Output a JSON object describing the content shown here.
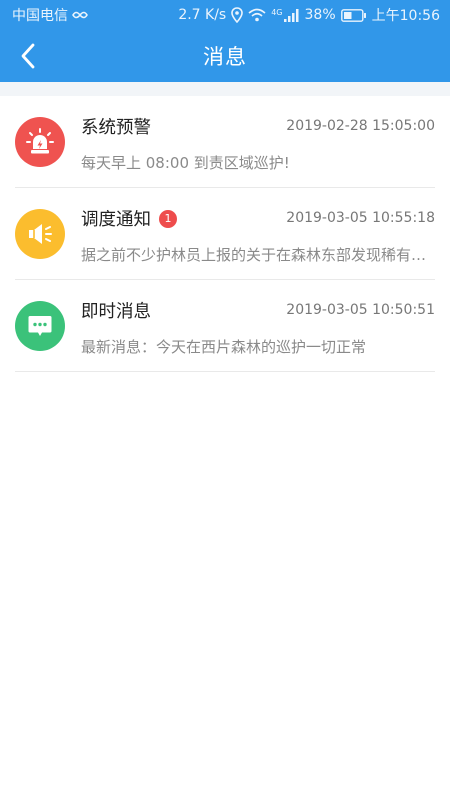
{
  "statusbar": {
    "carrier": "中国电信",
    "speed": "2.7 K/s",
    "network": "4G",
    "battery": "38%",
    "time": "上午10:56"
  },
  "header": {
    "title": "消息"
  },
  "colors": {
    "primary": "#3197e9",
    "alert": "#ef5350",
    "dispatch": "#fbbd2e",
    "instant": "#3bc27a",
    "badge": "#ee4c4c"
  },
  "messages": [
    {
      "icon": "alarm-light-icon",
      "title": "系统预警",
      "time": "2019-02-28 15:05:00",
      "preview": "每天早上 08:00 到责区域巡护!",
      "badge": ""
    },
    {
      "icon": "speaker-icon",
      "title": "调度通知",
      "time": "2019-03-05 10:55:18",
      "preview": "据之前不少护林员上报的关于在森林东部发现稀有植物的情况",
      "badge": "1"
    },
    {
      "icon": "chat-bubble-icon",
      "title": "即时消息",
      "time": "2019-03-05 10:50:51",
      "preview": "最新消息：今天在西片森林的巡护一切正常",
      "badge": ""
    }
  ]
}
